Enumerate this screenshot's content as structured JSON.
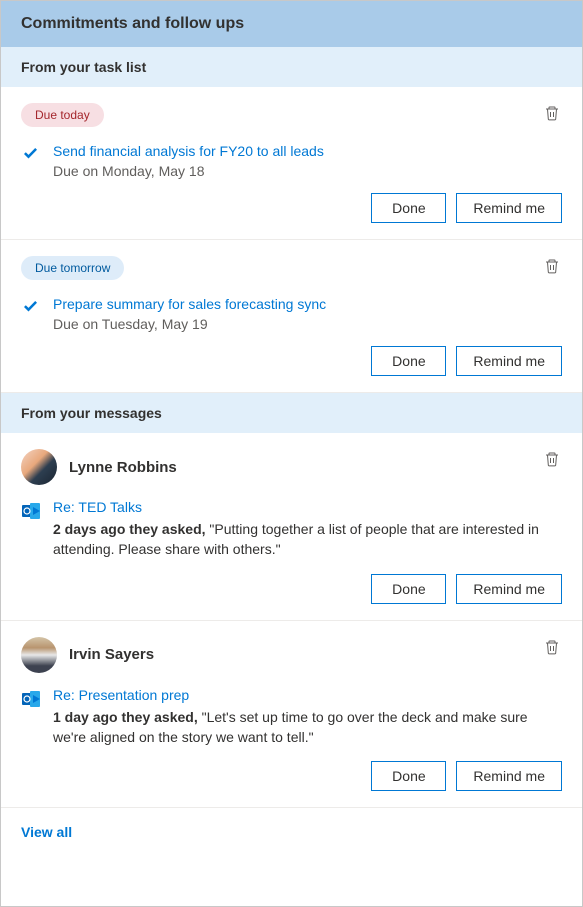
{
  "header": "Commitments and follow ups",
  "sections": {
    "tasks_header": "From your task list",
    "messages_header": "From your messages"
  },
  "tasks": [
    {
      "badge": "Due today",
      "title": "Send financial analysis for FY20 to all leads",
      "due": "Due on Monday, May 18"
    },
    {
      "badge": "Due tomorrow",
      "title": "Prepare summary for sales forecasting sync",
      "due": "Due on Tuesday, May 19"
    }
  ],
  "messages": [
    {
      "sender": "Lynne Robbins",
      "subject": "Re: TED Talks",
      "prefix": "2 days ago they asked,",
      "quote": " \"Putting together a list of people that are interested in attending. Please share with others.\""
    },
    {
      "sender": "Irvin Sayers",
      "subject": "Re: Presentation prep",
      "prefix": "1 day ago they asked,",
      "quote": " \"Let's set up time to go over the deck and make sure we're aligned on the story we want to tell.\""
    }
  ],
  "buttons": {
    "done": "Done",
    "remind": "Remind me"
  },
  "view_all": "View all"
}
